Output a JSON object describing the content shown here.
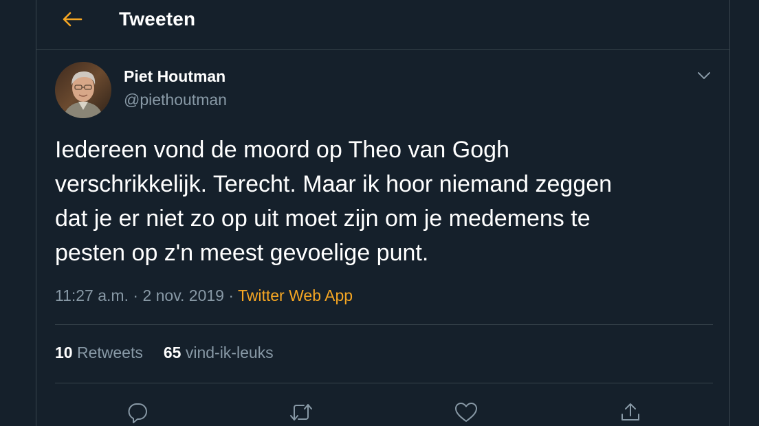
{
  "header": {
    "back_icon": "arrow-left-icon",
    "title": "Tweeten"
  },
  "tweet": {
    "author": {
      "name": "Piet Houtman",
      "handle": "@piethoutman",
      "avatar_icon": "user-photo"
    },
    "more_icon": "chevron-down-icon",
    "text_lines": [
      "Iedereen vond de moord op Theo van Gogh",
      "verschrikkelijk. Terecht. Maar ik hoor niemand zeggen",
      "dat je er niet zo op uit moet zijn om je medemens te",
      "pesten op z'n meest gevoelige punt."
    ],
    "time": "11:27 a.m.",
    "separator": " · ",
    "date": "2 nov. 2019",
    "source": "Twitter Web App",
    "stats": {
      "retweets_count": "10",
      "retweets_label": "Retweets",
      "likes_count": "65",
      "likes_label": "vind-ik-leuks"
    },
    "actions": [
      {
        "name": "reply",
        "icon": "reply-icon"
      },
      {
        "name": "retweet",
        "icon": "retweet-icon"
      },
      {
        "name": "like",
        "icon": "heart-icon"
      },
      {
        "name": "share",
        "icon": "share-icon"
      }
    ]
  },
  "colors": {
    "background": "#15202b",
    "accent": "#f5a623",
    "text_primary": "#ffffff",
    "text_secondary": "#8899a6",
    "border": "#38444d"
  }
}
